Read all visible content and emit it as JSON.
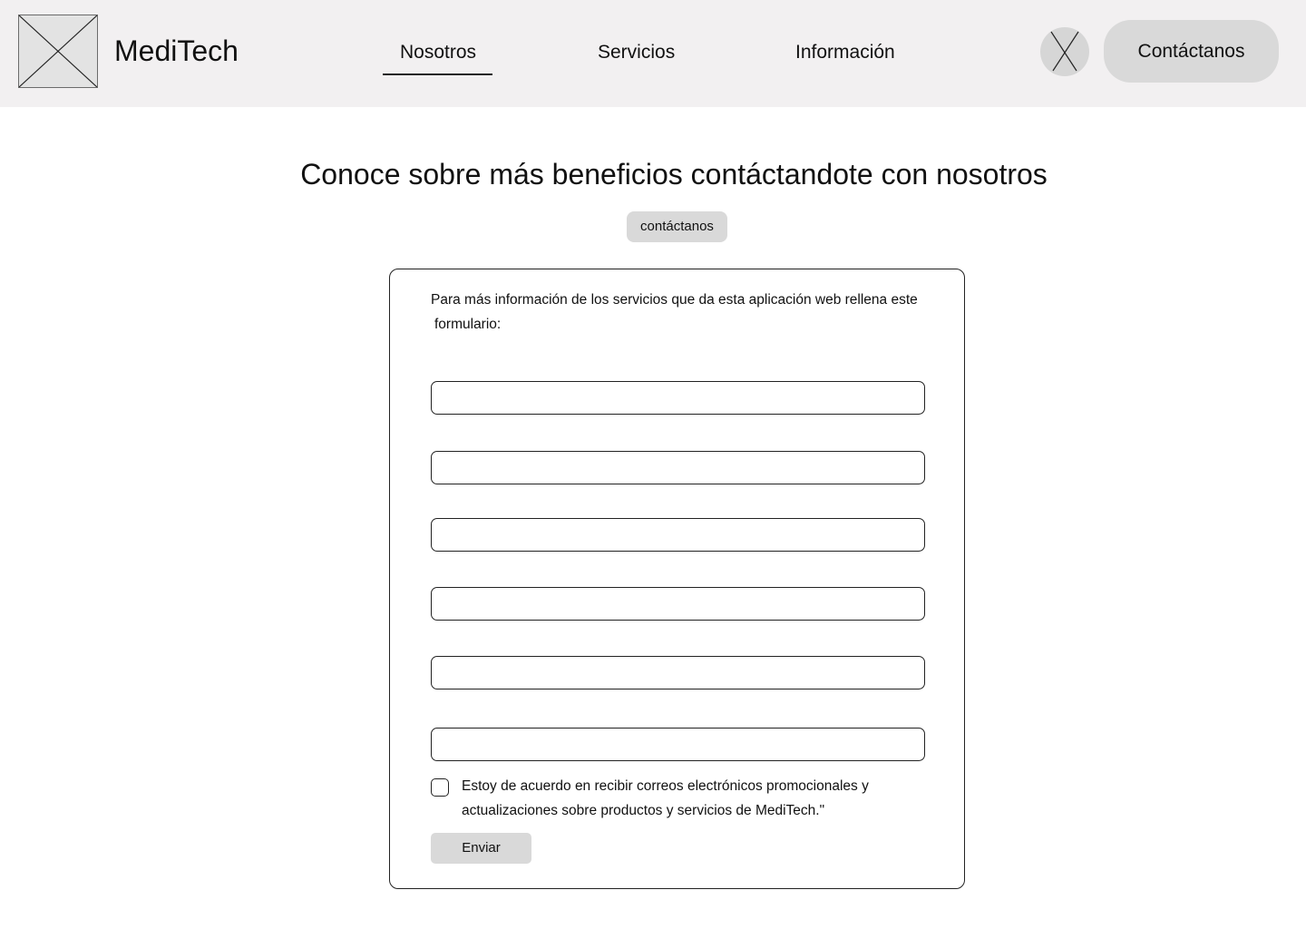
{
  "header": {
    "logo_icon": "image-placeholder-icon",
    "brand": "MediTech",
    "nav": [
      {
        "label": "Nosotros",
        "active": true
      },
      {
        "label": "Servicios",
        "active": false
      },
      {
        "label": "Información",
        "active": false
      }
    ],
    "avatar_icon": "avatar-placeholder-icon",
    "contact_button_label": "Contáctanos"
  },
  "main": {
    "title": "Conoce sobre más beneficios contáctandote con nosotros",
    "tag_button_label": "contáctanos",
    "form": {
      "intro_line1": "Para más información de los servicios que da esta aplicación web rellena este",
      "intro_line2": "formulario:",
      "fields": [
        "",
        "",
        "",
        "",
        "",
        ""
      ],
      "consent_line1": "Estoy de acuerdo en recibir correos electrónicos promocionales y",
      "consent_line2": "actualizaciones sobre productos y servicios de MediTech.\"",
      "consent_checked": false,
      "submit_label": "Enviar"
    }
  },
  "colors": {
    "header_bg": "#f2f0f1",
    "button_bg": "#d9d9d9",
    "placeholder_bg": "#e3e3e3"
  }
}
